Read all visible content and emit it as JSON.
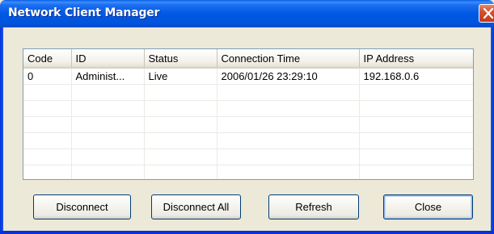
{
  "window": {
    "title": "Network Client Manager"
  },
  "table": {
    "columns": [
      "Code",
      "ID",
      "Status",
      "Connection Time",
      "IP Address"
    ],
    "rows": [
      [
        "0",
        "Administ...",
        "Live",
        "2006/01/26 23:29:10",
        "192.168.0.6"
      ]
    ]
  },
  "buttons": {
    "disconnect": "Disconnect",
    "disconnect_all": "Disconnect All",
    "refresh": "Refresh",
    "close": "Close"
  },
  "colors": {
    "titlebar": "#0058e4",
    "close_button": "#d4502e",
    "dialog_background": "#ece9d8"
  },
  "icons": {
    "close": "close-icon"
  }
}
